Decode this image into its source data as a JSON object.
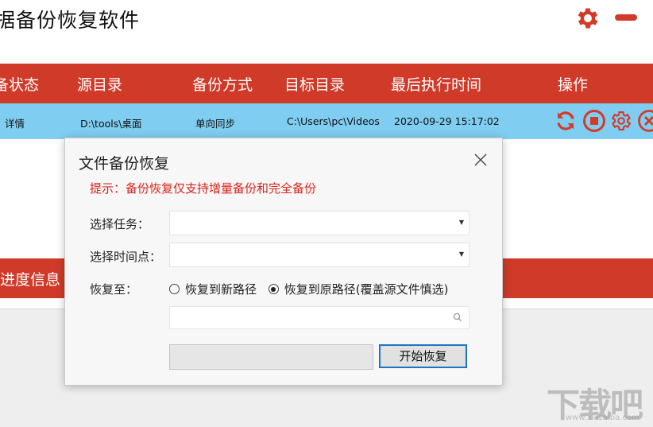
{
  "app": {
    "title": "据备份恢复软件"
  },
  "titlebar": {
    "settings_icon": "gear-icon",
    "minimize_icon": "minimize-icon",
    "accent": "#d23b2a"
  },
  "table": {
    "headers": [
      "备状态",
      "源目录",
      "备份方式",
      "目标目录",
      "最后执行时间",
      "操作"
    ],
    "rows": [
      {
        "status": "详情",
        "source": "D:\\tools\\桌面",
        "mode": "单向同步",
        "target": "C:\\Users\\pc\\Videos",
        "last_run": "2020-09-29 15:17:02"
      }
    ],
    "header_color": "#cf3a29",
    "row_color": "#7fcdf0"
  },
  "progress_section": {
    "label": "进度信息"
  },
  "dialog": {
    "title": "文件备份恢复",
    "hint": "提示：备份恢复仅支持增量备份和完全备份",
    "task_label": "选择任务：",
    "task_value": "",
    "timepoint_label": "选择时间点：",
    "timepoint_value": "",
    "restore_to_label": "恢复至：",
    "options": [
      "恢复到新路径",
      "恢复到原路径(覆盖源文件慎选)"
    ],
    "selected_option": 1,
    "path_value": "",
    "start_button": "开始恢复",
    "hint_color": "#d8231b"
  },
  "watermark": {
    "text": "下载吧",
    "sub": "www.xiazaiba.com"
  }
}
